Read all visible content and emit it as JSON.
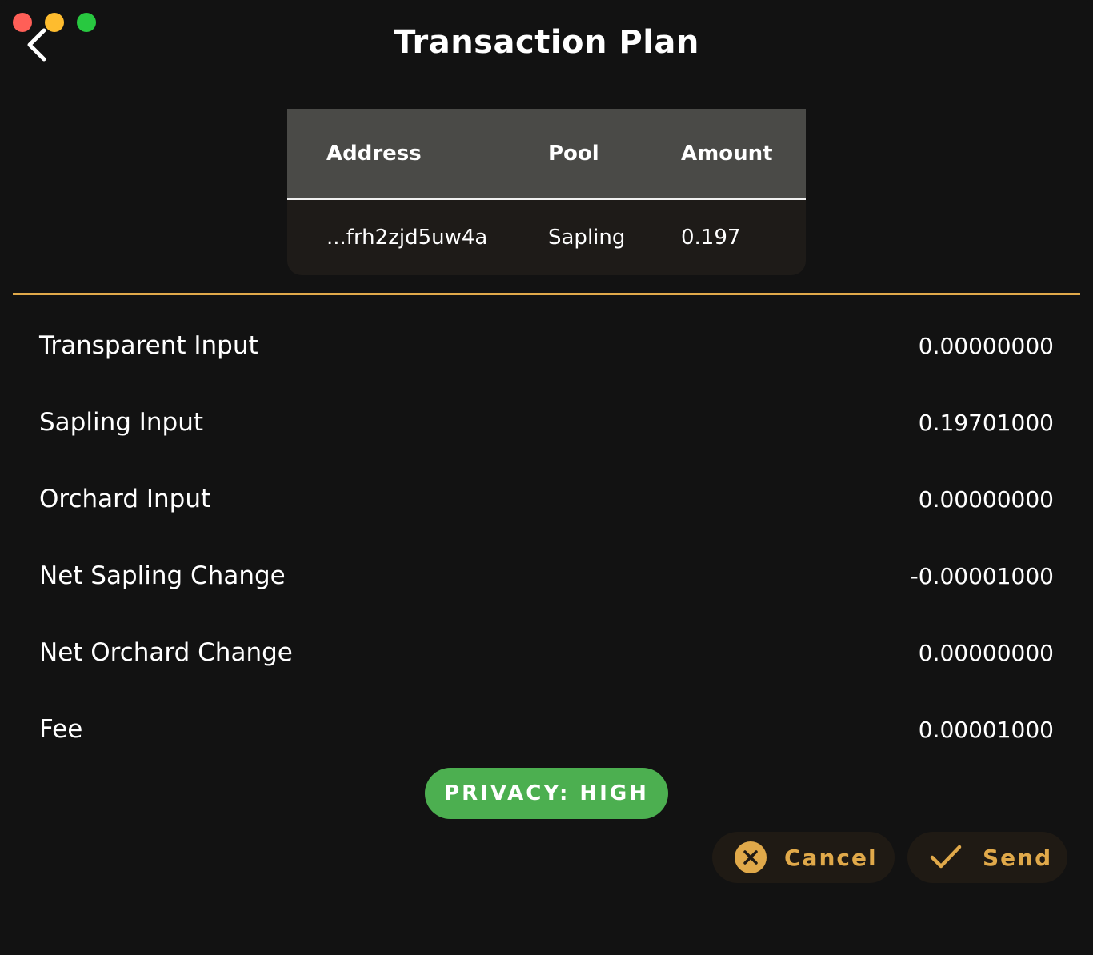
{
  "window": {
    "title": "Transaction Plan",
    "accent_color": "#e0a94a",
    "background_color": "#121212"
  },
  "table": {
    "headers": {
      "address": "Address",
      "pool": "Pool",
      "amount": "Amount"
    },
    "rows": [
      {
        "address": "...frh2zjd5uw4a",
        "pool": "Sapling",
        "amount": "0.197"
      }
    ]
  },
  "summary": {
    "rows": [
      {
        "label": "Transparent Input",
        "value": "0.00000000"
      },
      {
        "label": "Sapling Input",
        "value": "0.19701000"
      },
      {
        "label": "Orchard Input",
        "value": "0.00000000"
      },
      {
        "label": "Net Sapling Change",
        "value": "-0.00001000"
      },
      {
        "label": "Net Orchard Change",
        "value": "0.00000000"
      },
      {
        "label": "Fee",
        "value": "0.00001000"
      }
    ]
  },
  "privacy": {
    "label": "PRIVACY: HIGH",
    "color": "#4caf50"
  },
  "actions": {
    "cancel_label": "Cancel",
    "send_label": "Send",
    "cancel_icon": "close-circle-icon",
    "send_icon": "check-icon"
  }
}
